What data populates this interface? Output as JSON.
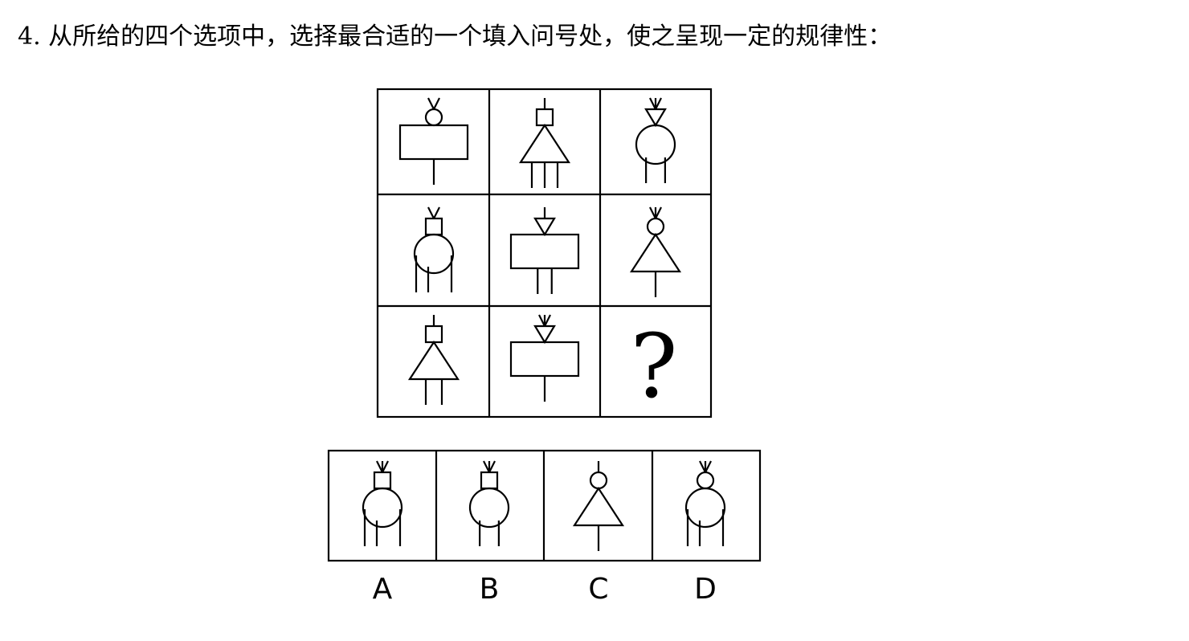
{
  "question": {
    "text": "4. 从所给的四个选项中，选择最合适的一个填入问号处，使之呈现一定的规律性："
  },
  "grid": {
    "unknown_mark": "?",
    "cells": [
      {
        "row": 1,
        "col": 1,
        "top": "circle",
        "body": "rectangle",
        "legs": 1,
        "antenna": "v"
      },
      {
        "row": 1,
        "col": 2,
        "top": "square",
        "body": "triangle",
        "legs": 3,
        "antenna": "line"
      },
      {
        "row": 1,
        "col": 3,
        "top": "triangle",
        "body": "circle",
        "legs": 2,
        "antenna": "arrow"
      },
      {
        "row": 2,
        "col": 1,
        "top": "square",
        "body": "circle",
        "legs": 3,
        "antenna": "v"
      },
      {
        "row": 2,
        "col": 2,
        "top": "triangle",
        "body": "rectangle",
        "legs": 2,
        "antenna": "line"
      },
      {
        "row": 2,
        "col": 3,
        "top": "circle",
        "body": "triangle",
        "legs": 1,
        "antenna": "arrow"
      },
      {
        "row": 3,
        "col": 1,
        "top": "square",
        "body": "triangle",
        "legs": 2,
        "antenna": "line"
      },
      {
        "row": 3,
        "col": 2,
        "top": "triangle",
        "body": "rectangle",
        "legs": 1,
        "antenna": "arrow"
      },
      {
        "row": 3,
        "col": 3,
        "unknown": true
      }
    ]
  },
  "options": [
    {
      "label": "A",
      "top": "square",
      "body": "circle",
      "legs": 3,
      "antenna": "arrow"
    },
    {
      "label": "B",
      "top": "square",
      "body": "circle",
      "legs": 2,
      "antenna": "arrow"
    },
    {
      "label": "C",
      "top": "circle",
      "body": "triangle",
      "legs": 1,
      "antenna": "line"
    },
    {
      "label": "D",
      "top": "circle",
      "body": "circle",
      "legs": 3,
      "antenna": "arrow"
    }
  ]
}
